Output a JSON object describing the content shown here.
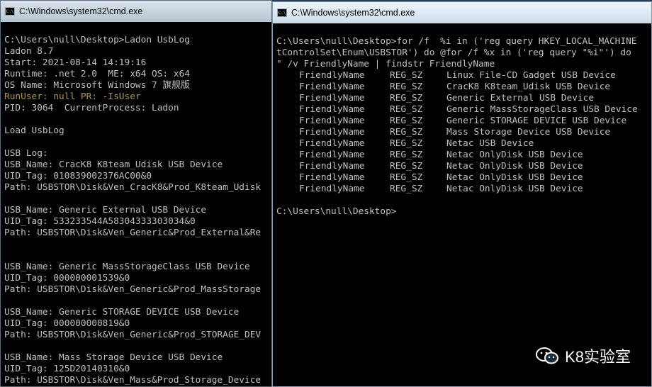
{
  "left_window": {
    "title": "C:\\Windows\\system32\\cmd.exe",
    "lines": [
      "C:\\Users\\null\\Desktop>Ladon UsbLog",
      "Ladon 8.7",
      "Start: 2021-08-14 14:19:16",
      "Runtime: .net 2.0  ME: x64 OS: x64",
      "OS Name: Microsoft Windows 7 旗舰版",
      "RunUser: null PR: -IsUser",
      "PID: 3064  CurrentProcess: Ladon",
      "",
      "Load UsbLog",
      "",
      "USB Log:",
      "USB_Name: CracK8 K8team_Udisk USB Device",
      "UID_Tag: 010839002376AC00&0",
      "Path: USBSTOR\\Disk&Ven_CracK8&Prod_K8team_Udisk",
      "",
      "USB_Name: Generic External USB Device",
      "UID_Tag: 533233544A58304333303034&0",
      "Path: USBSTOR\\Disk&Ven_Generic&Prod_External&Re",
      "",
      "",
      "USB_Name: Generic MassStorageClass USB Device",
      "UID_Tag: 000000001539&0",
      "Path: USBSTOR\\Disk&Ven_Generic&Prod_MassStorage",
      "",
      "USB_Name: Generic STORAGE DEVICE USB Device",
      "UID_Tag: 000000000819&0",
      "Path: USBSTOR\\Disk&Ven_Generic&Prod_STORAGE_DEV",
      "",
      "USB_Name: Mass Storage Device USB Device",
      "UID_Tag: 125D20140310&0",
      "Path: USBSTOR\\Disk&Ven_Mass&Prod_Storage_Device"
    ]
  },
  "right_window": {
    "title": "C:\\Windows\\system32\\cmd.exe",
    "command_lines": [
      "C:\\Users\\null\\Desktop>for /f  %i in ('reg query HKEY_LOCAL_MACHINE",
      "tControlSet\\Enum\\USBSTOR') do @for /f %x in ('reg query \"%i\"') do",
      "\" /v FriendlyName | findstr FriendlyName"
    ],
    "rows": [
      {
        "name": "FriendlyName",
        "type": "REG_SZ",
        "value": "Linux File-CD Gadget USB Device"
      },
      {
        "name": "FriendlyName",
        "type": "REG_SZ",
        "value": "CracK8 K8team_Udisk USB Device"
      },
      {
        "name": "FriendlyName",
        "type": "REG_SZ",
        "value": "Generic External USB Device"
      },
      {
        "name": "FriendlyName",
        "type": "REG_SZ",
        "value": "Generic MassStorageClass USB Device"
      },
      {
        "name": "FriendlyName",
        "type": "REG_SZ",
        "value": "Generic STORAGE DEVICE USB Device"
      },
      {
        "name": "FriendlyName",
        "type": "REG_SZ",
        "value": "Mass Storage Device USB Device"
      },
      {
        "name": "FriendlyName",
        "type": "REG_SZ",
        "value": "Netac USB Device"
      },
      {
        "name": "FriendlyName",
        "type": "REG_SZ",
        "value": "Netac OnlyDisk USB Device"
      },
      {
        "name": "FriendlyName",
        "type": "REG_SZ",
        "value": "Netac OnlyDisk USB Device"
      },
      {
        "name": "FriendlyName",
        "type": "REG_SZ",
        "value": "Netac OnlyDisk USB Device"
      },
      {
        "name": "FriendlyName",
        "type": "REG_SZ",
        "value": "Netac OnlyDisk USB Device"
      }
    ],
    "prompt": "C:\\Users\\null\\Desktop>"
  },
  "watermark": {
    "text": "K8实验室",
    "icon": "wechat-icon"
  },
  "colors": {
    "console_text": "#c0c0c0",
    "console_bg": "#000000",
    "runuser_text": "#a89a4a"
  }
}
